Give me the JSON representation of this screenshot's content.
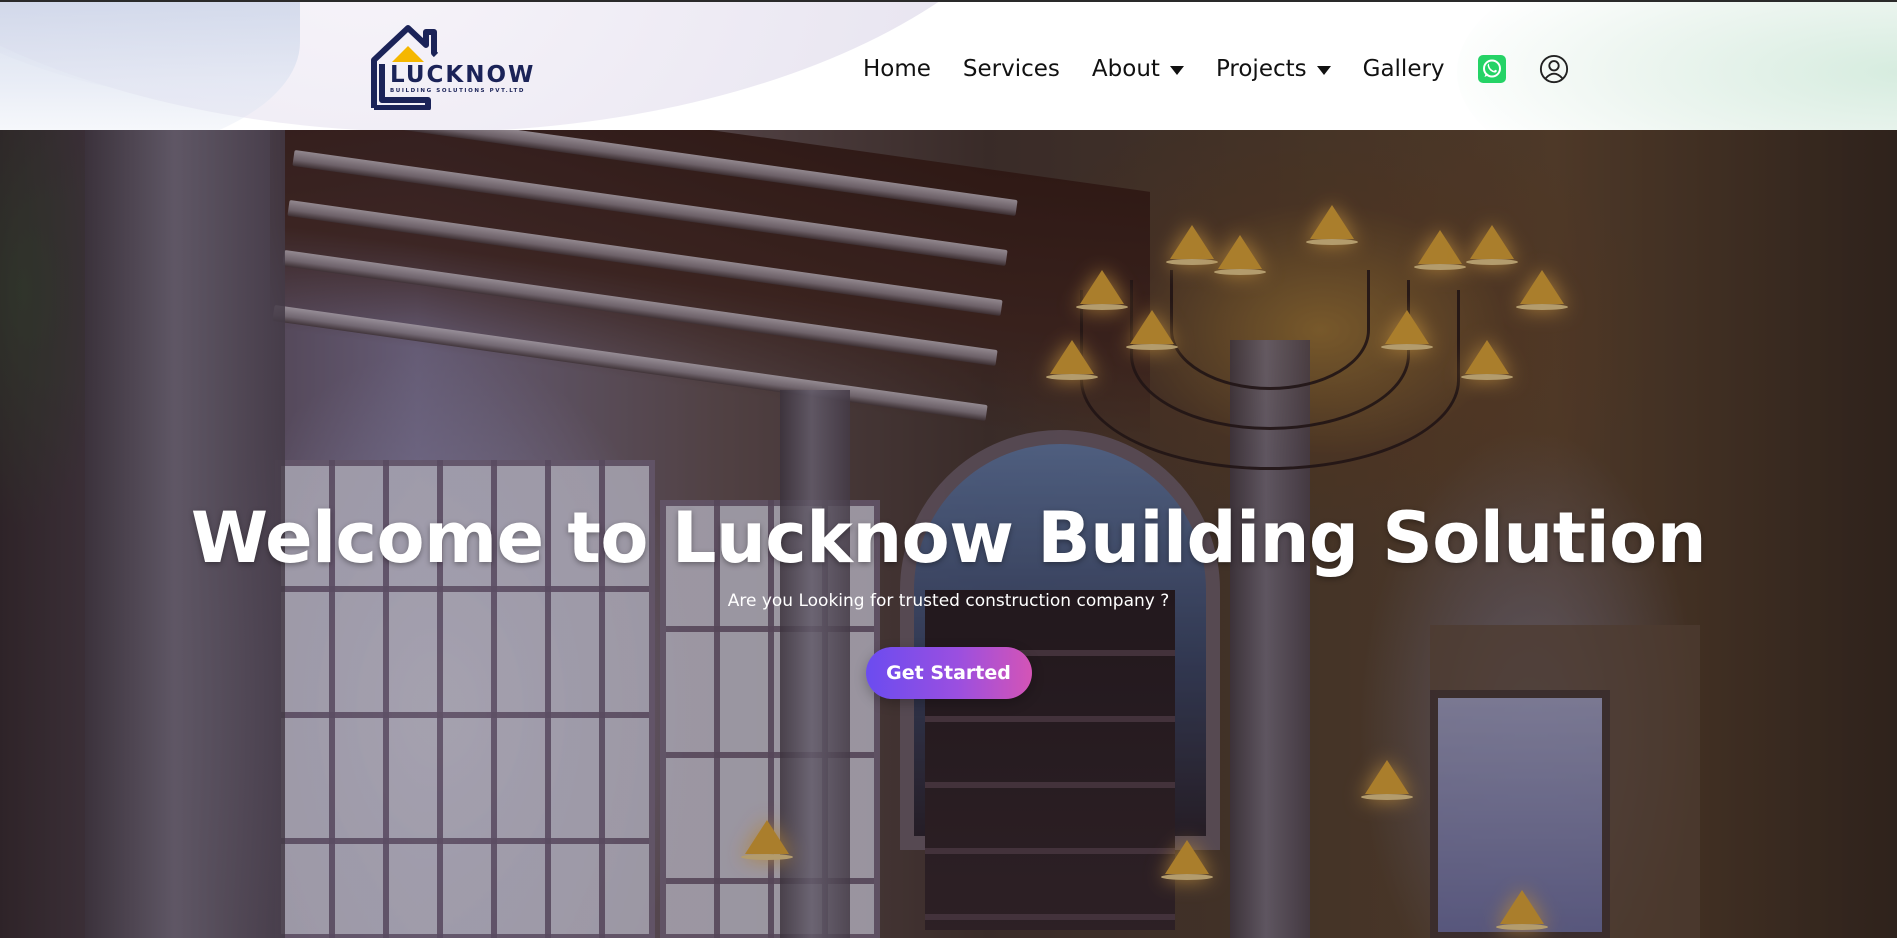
{
  "brand": {
    "name": "LUCKNOW",
    "tagline": "BUILDING SOLUTIONS PVT.LTD",
    "colors": {
      "navy": "#1b2358",
      "roof": "#f5b700"
    }
  },
  "nav": {
    "items": [
      {
        "label": "Home",
        "dropdown": false
      },
      {
        "label": "Services",
        "dropdown": false
      },
      {
        "label": "About",
        "dropdown": true
      },
      {
        "label": "Projects",
        "dropdown": true
      },
      {
        "label": "Gallery",
        "dropdown": false
      }
    ],
    "icons": [
      "whatsapp-icon",
      "user-account-icon"
    ],
    "whatsapp_color": "#25d366"
  },
  "hero": {
    "title": "Welcome to Lucknow Building Solution",
    "subtitle": "Are you Looking for trusted construction company ?",
    "cta_label": "Get Started",
    "cta_gradient": [
      "#6b4cf0",
      "#d454b6"
    ]
  }
}
